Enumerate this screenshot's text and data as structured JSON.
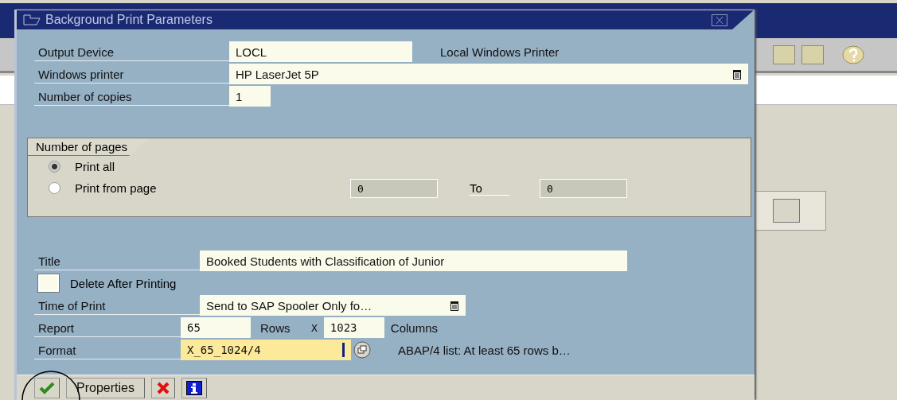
{
  "window": {
    "title": "Background Print Parameters"
  },
  "fields": [
    {
      "label": "Output Device",
      "value": "LOCL",
      "description": "Local Windows Printer",
      "has_help": false
    },
    {
      "label": "Windows printer",
      "value": "HP LaserJet 5P",
      "has_help": true
    },
    {
      "label": "Number of copies",
      "value": "1",
      "has_help": false
    }
  ],
  "pages": {
    "title": "Number of pages",
    "options": [
      {
        "label": "Print all",
        "selected": true
      },
      {
        "label": "Print from page",
        "selected": false
      }
    ],
    "from": "0",
    "to_label": "To",
    "to": "0"
  },
  "title_field": {
    "label": "Title",
    "value": "Booked Students with Classification of Junior"
  },
  "delete_after_printing": {
    "label": "Delete After Printing",
    "checked": false
  },
  "time_of_print": {
    "label": "Time of Print",
    "value": "Send to SAP Spooler Only fo…"
  },
  "report": {
    "label": "Report",
    "rows": "65",
    "rows_label": "Rows",
    "x": "X",
    "columns": "1023",
    "columns_label": "Columns"
  },
  "format": {
    "label": "Format",
    "value": "X_65_1024/4",
    "description": "ABAP/4 list: At least 65 rows b…"
  },
  "buttons": [
    {
      "kind": "confirm"
    },
    {
      "kind": "text",
      "label": "Properties"
    },
    {
      "kind": "cancel"
    },
    {
      "kind": "info"
    }
  ]
}
